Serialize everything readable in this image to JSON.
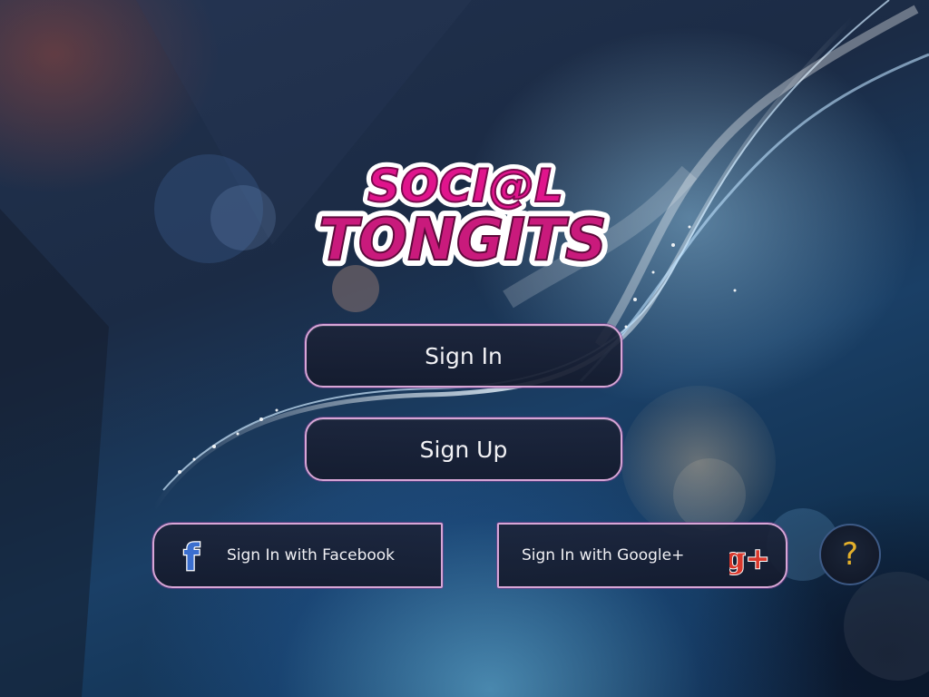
{
  "app": {
    "logo_line1": "SOCI@L",
    "logo_line2": "TONGITS"
  },
  "buttons": {
    "sign_in": "Sign In",
    "sign_up": "Sign Up",
    "facebook": "Sign In with Facebook",
    "google": "Sign In with Google+",
    "help": "?"
  },
  "icons": {
    "facebook": "facebook-icon",
    "google": "google-plus-icon",
    "google_glyph": "g+",
    "facebook_glyph": "f"
  },
  "colors": {
    "logo_pink": "#e0148c",
    "button_border": "#d7a6d6",
    "help_accent": "#e4b02b",
    "google_red": "#d9372b",
    "facebook_blue": "#3b6fcf"
  }
}
